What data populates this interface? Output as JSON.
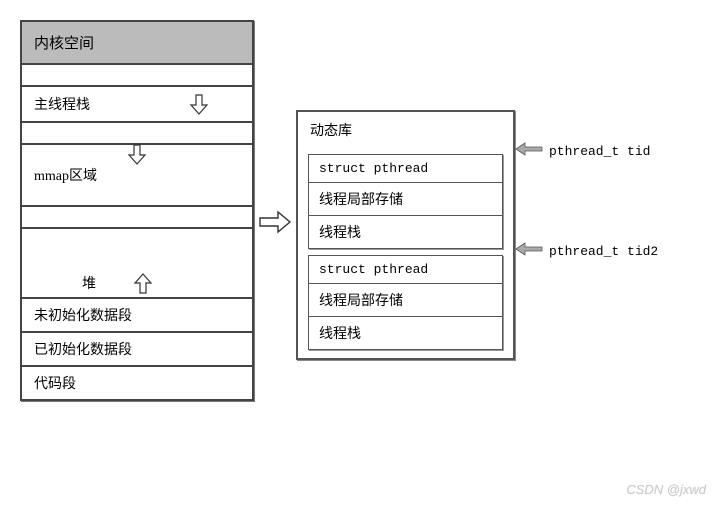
{
  "left": {
    "kernel": "内核空间",
    "main_stack": "主线程栈",
    "mmap": "mmap区域",
    "heap": "堆",
    "bss": "未初始化数据段",
    "data": "已初始化数据段",
    "text": "代码段"
  },
  "right": {
    "header": "动态库",
    "rows": {
      "struct": "struct pthread",
      "tls": "线程局部存储",
      "stack": "线程栈"
    }
  },
  "ptrs": {
    "tid1": "pthread_t tid",
    "tid2": "pthread_t tid2"
  },
  "watermark": "CSDN @jxwd"
}
